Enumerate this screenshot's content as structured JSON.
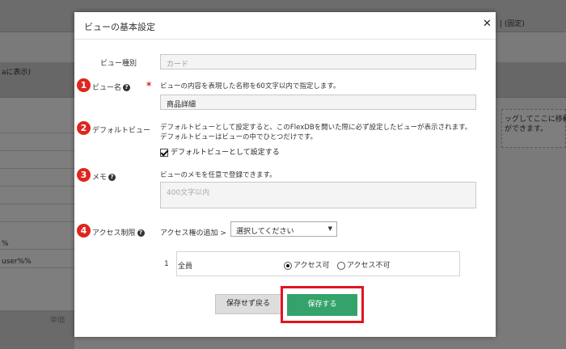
{
  "background": {
    "header_right": "| (固定)",
    "left_band_label": "aに表示)",
    "right_drop_text": "ッグしてここに移動\nができます。",
    "left_row_1": "%",
    "left_row_2": "user%%",
    "bottom_label": "単価"
  },
  "modal": {
    "title": "ビューの基本設定",
    "close_glyph": "✕",
    "view_type": {
      "label": "ビュー種別",
      "value": "カード"
    },
    "view_name": {
      "badge": "1",
      "label": "ビュー名",
      "required_mark": "*",
      "description": "ビューの内容を表現した名称を60文字以内で指定します。",
      "value": "商品詳細"
    },
    "default_view": {
      "badge": "2",
      "label": "デフォルトビュー",
      "description": "デフォルトビューとして設定すると、このFlexDBを開いた際に必ず設定したビューが表示されます。デフォルトビューはビューの中でひとつだけです。",
      "checkbox_label": "デフォルトビューとして設定する",
      "checked": true
    },
    "memo": {
      "badge": "3",
      "label": "メモ",
      "description": "ビューのメモを任意で登録できます。",
      "placeholder": "400文字以内"
    },
    "access": {
      "badge": "4",
      "label": "アクセス制限",
      "add_label": "アクセス権の追加 >",
      "select_value": "選択してください",
      "rows": [
        {
          "index": "1",
          "name": "全員",
          "option_allow": "アクセス可",
          "option_deny": "アクセス不可",
          "selected": "allow"
        }
      ]
    },
    "buttons": {
      "back": "保存せず戻る",
      "save": "保存する"
    }
  },
  "colors": {
    "badge": "#e0261d",
    "save": "#34a36b",
    "highlight": "#e0151f"
  }
}
